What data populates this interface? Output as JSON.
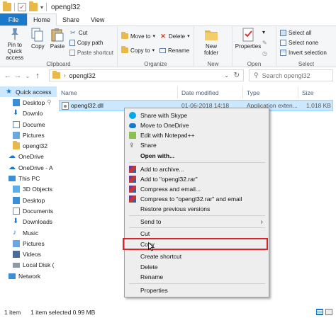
{
  "window": {
    "title": "opengl32"
  },
  "tabs": [
    "File",
    "Home",
    "Share",
    "View"
  ],
  "ribbon": {
    "clipboard": {
      "label": "Clipboard",
      "pin": "Pin to Quick access",
      "copy": "Copy",
      "paste": "Paste",
      "cut": "Cut",
      "copy_path": "Copy path",
      "paste_shortcut": "Paste shortcut"
    },
    "organize": {
      "label": "Organize",
      "move_to": "Move to",
      "copy_to": "Copy to",
      "delete": "Delete",
      "rename": "Rename"
    },
    "new": {
      "label": "New",
      "new_folder": "New folder"
    },
    "open": {
      "label": "Open",
      "properties": "Properties"
    },
    "select": {
      "label": "Select",
      "select_all": "Select all",
      "select_none": "Select none",
      "invert": "Invert selection"
    }
  },
  "address": {
    "path": "opengl32",
    "search_placeholder": "Search opengl32"
  },
  "nav": {
    "items": [
      "Quick access",
      "Desktop",
      "Downlo",
      "Docume",
      "Pictures",
      "opengl32",
      "OneDrive",
      "OneDrive - A",
      "This PC",
      "3D Objects",
      "Desktop",
      "Documents",
      "Downloads",
      "Music",
      "Pictures",
      "Videos",
      "Local Disk (",
      "Network"
    ]
  },
  "columns": {
    "name": "Name",
    "date": "Date modified",
    "type": "Type",
    "size": "Size"
  },
  "file": {
    "name": "opengl32.dll",
    "date": "01-06-2018 14:18",
    "type": "Application exten...",
    "size": "1,018 KB"
  },
  "context_menu": {
    "share_skype": "Share with Skype",
    "move_onedrive": "Move to OneDrive",
    "edit_notepad": "Edit with Notepad++",
    "share": "Share",
    "open_with": "Open with...",
    "add_archive": "Add to archive...",
    "add_rar": "Add to \"opengl32.rar\"",
    "compress_email": "Compress and email...",
    "compress_rar_email": "Compress to \"opengl32.rar\" and email",
    "restore": "Restore previous versions",
    "send_to": "Send to",
    "cut": "Cut",
    "copy": "Copy",
    "create_shortcut": "Create shortcut",
    "delete": "Delete",
    "rename": "Rename",
    "properties": "Properties"
  },
  "status": {
    "count": "1 item",
    "selected": "1 item selected  0.99 MB"
  },
  "colors": {
    "accent": "#1979ca",
    "selection": "#cce8ff",
    "highlight_box": "#d9232d"
  }
}
